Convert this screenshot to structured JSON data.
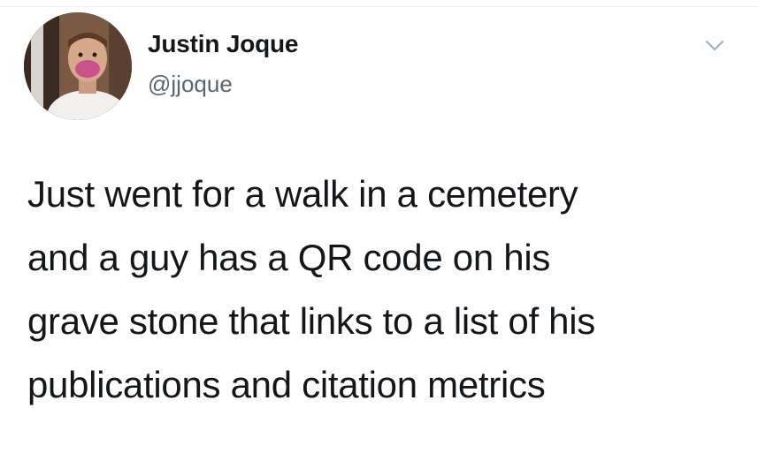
{
  "author": {
    "display_name": "Justin Joque",
    "handle": "@jjoque",
    "avatar_icon": "user-avatar-photo"
  },
  "menu": {
    "icon": "chevron-down-icon"
  },
  "tweet": {
    "lines": [
      "Just went for a walk in a cemetery",
      "and a guy has a QR code on his",
      "grave stone that links to a list of his",
      "publications and citation metrics"
    ]
  },
  "colors": {
    "text_primary": "#14171a",
    "text_secondary": "#5b6670",
    "background": "#ffffff"
  }
}
